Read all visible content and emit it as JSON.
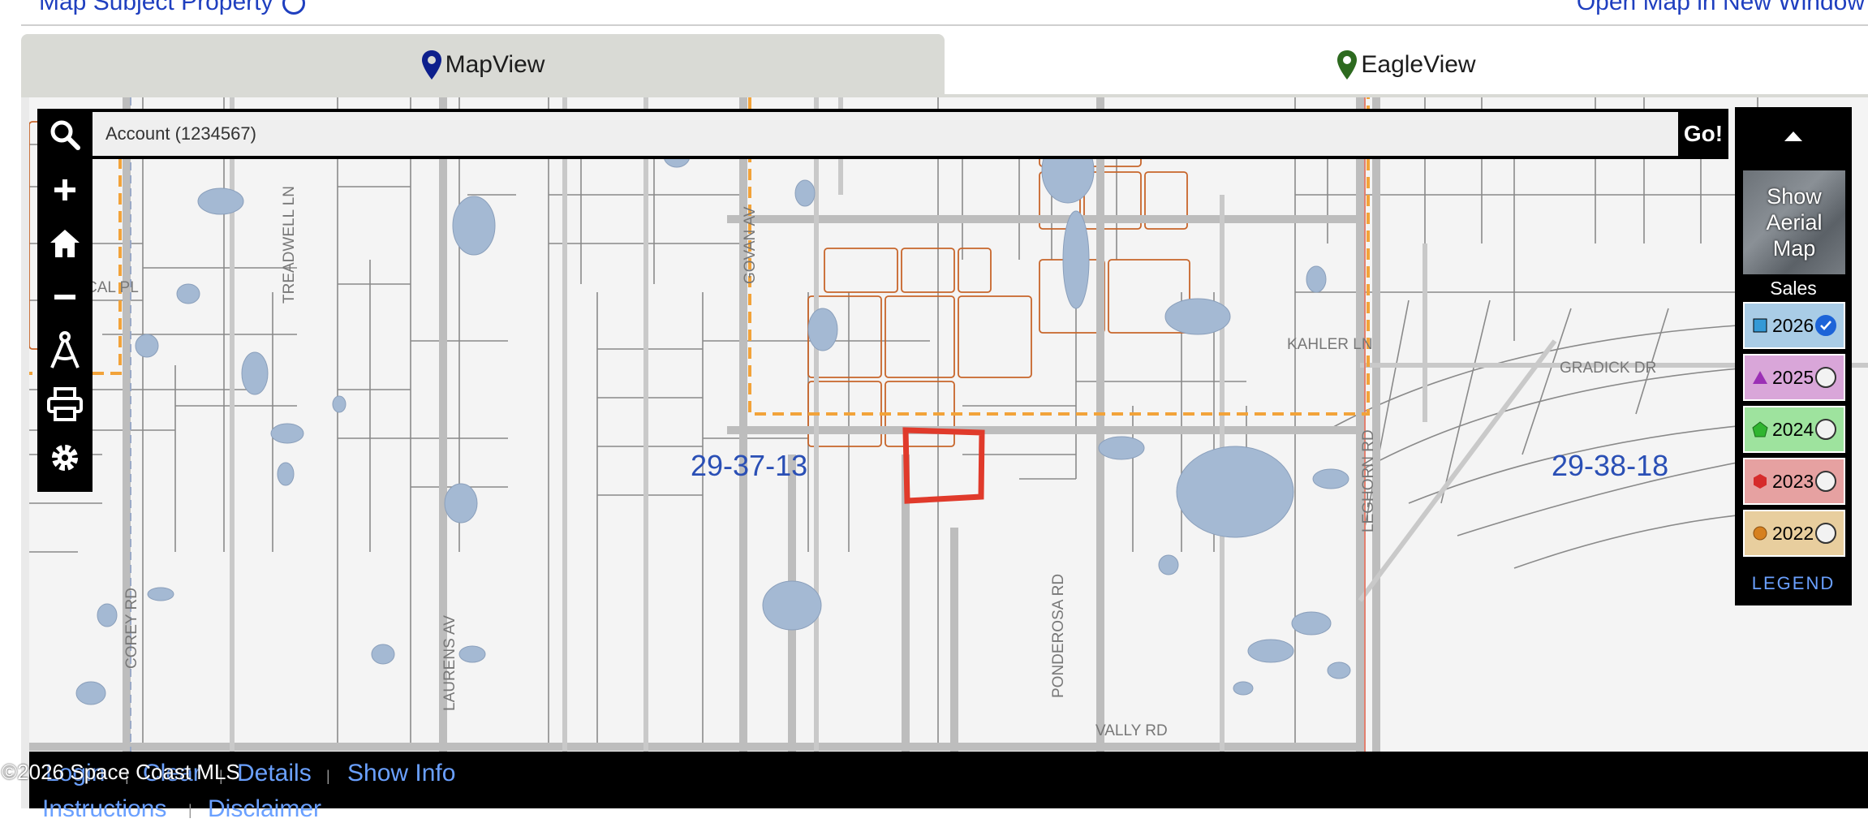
{
  "header": {
    "left_link": "Map Subject Property",
    "right_link": "Open Map in New Window"
  },
  "tabs": [
    {
      "label": "MapView",
      "pin_color": "#0d1f8c"
    },
    {
      "label": "EagleView",
      "pin_color": "#2d6a1f"
    }
  ],
  "search": {
    "value": "Account (1234567)",
    "go_label": "Go!"
  },
  "toolbar": [
    "search-icon",
    "zoom-in-icon",
    "home-icon",
    "zoom-out-icon",
    "measure-icon",
    "print-icon",
    "gear-icon"
  ],
  "map": {
    "section_labels": [
      "29-37-13",
      "29-38-18"
    ],
    "road_labels": [
      "TREADWELL LN",
      "CAL PL",
      "GOVAN AV",
      "KAHLER LN",
      "GRADICK DR",
      "LEGHORN RD",
      "COREY RD",
      "LAURENS AV",
      "PONDEROSA RD",
      "VALLY RD"
    ],
    "road_color": "#bdbdbd",
    "parcel_line_color": "#7c7c7c",
    "water_color": "#a4b9d3",
    "boundary_color": "#f2a33a",
    "selection_color": "#e03a2b"
  },
  "right_panel": {
    "aerial_label": "Show Aerial Map",
    "sales_label": "Sales",
    "years": [
      {
        "year": "2026",
        "checked": true,
        "bg": "#a9cce6",
        "marker": "square",
        "marker_color": "#3399d6"
      },
      {
        "year": "2025",
        "checked": false,
        "bg": "#d9a6d9",
        "marker": "triangle",
        "marker_color": "#9b30b5"
      },
      {
        "year": "2024",
        "checked": false,
        "bg": "#9ee39e",
        "marker": "pentagon",
        "marker_color": "#30b530"
      },
      {
        "year": "2023",
        "checked": false,
        "bg": "#e6a1a1",
        "marker": "hexagon",
        "marker_color": "#d62b2b"
      },
      {
        "year": "2022",
        "checked": false,
        "bg": "#e8ce9e",
        "marker": "circle",
        "marker_color": "#d6801f"
      }
    ],
    "legend_label": "LEGEND"
  },
  "bottom": {
    "links": [
      "Login",
      "Clear",
      "Details",
      "Show Info"
    ],
    "links_row2": [
      "Instructions",
      "Disclaimer"
    ],
    "copyright": "©2026 Space Coast MLS"
  }
}
